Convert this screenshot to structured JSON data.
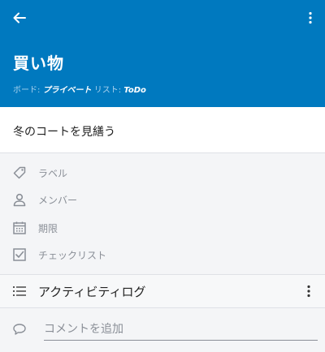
{
  "header": {
    "title": "買い物",
    "board_label": "ボード:",
    "board_value": "プライベート",
    "list_label": "リスト:",
    "list_value": "ToDo",
    "color": "#0079bf"
  },
  "card": {
    "title": "冬のコートを見繕う"
  },
  "options": [
    {
      "label": "ラベル",
      "icon": "tag-icon"
    },
    {
      "label": "メンバー",
      "icon": "person-icon"
    },
    {
      "label": "期限",
      "icon": "calendar-icon"
    },
    {
      "label": "チェックリスト",
      "icon": "checkbox-icon"
    }
  ],
  "activity": {
    "label": "アクティビティログ",
    "icon": "list-icon"
  },
  "comment": {
    "placeholder": "コメントを追加",
    "icon": "comment-icon"
  }
}
